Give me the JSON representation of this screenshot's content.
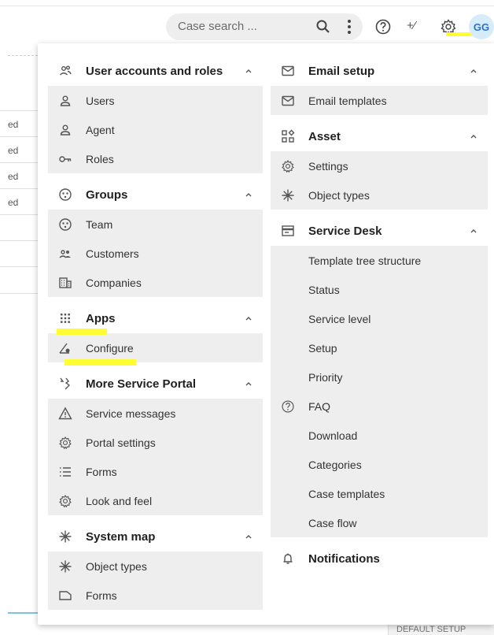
{
  "topbar": {
    "search_placeholder": "Case search ...",
    "avatar_initials": "GG",
    "plus_fx_glyph": "+⁄"
  },
  "background": {
    "rows": [
      "ed",
      "ed",
      "ed",
      "ed"
    ],
    "footer": "DEFAULT SETUP"
  },
  "menu": {
    "left": [
      {
        "title": "User accounts and roles",
        "icon": "users-icon",
        "items": [
          {
            "label": "Users",
            "icon": "person-icon"
          },
          {
            "label": "Agent",
            "icon": "person-icon"
          },
          {
            "label": "Roles",
            "icon": "key-icon"
          }
        ]
      },
      {
        "title": "Groups",
        "icon": "group-icon",
        "items": [
          {
            "label": "Team",
            "icon": "team-icon"
          },
          {
            "label": "Customers",
            "icon": "customers-icon"
          },
          {
            "label": "Companies",
            "icon": "building-icon"
          }
        ]
      },
      {
        "title": "Apps",
        "icon": "apps-grid-icon",
        "items": [
          {
            "label": "Configure",
            "icon": "configure-icon"
          }
        ]
      },
      {
        "title": "More Service Portal",
        "icon": "portal-icon",
        "items": [
          {
            "label": "Service messages",
            "icon": "warning-icon"
          },
          {
            "label": "Portal settings",
            "icon": "gear-icon"
          },
          {
            "label": "Forms",
            "icon": "list-icon"
          },
          {
            "label": "Look and feel",
            "icon": "gear-icon"
          }
        ]
      },
      {
        "title": "System map",
        "icon": "asterisk-icon",
        "items": [
          {
            "label": "Object types",
            "icon": "asterisk-icon"
          },
          {
            "label": "Forms",
            "icon": "form-icon"
          }
        ]
      }
    ],
    "right": [
      {
        "title": "Email setup",
        "icon": "mail-icon",
        "items": [
          {
            "label": "Email templates",
            "icon": "mail-icon"
          }
        ]
      },
      {
        "title": "Asset",
        "icon": "asset-icon",
        "items": [
          {
            "label": "Settings",
            "icon": "gear-icon"
          },
          {
            "label": "Object types",
            "icon": "asterisk-icon"
          }
        ]
      },
      {
        "title": "Service Desk",
        "icon": "desk-icon",
        "items": [
          {
            "label": "Template tree structure",
            "icon": ""
          },
          {
            "label": "Status",
            "icon": ""
          },
          {
            "label": "Service level",
            "icon": ""
          },
          {
            "label": "Setup",
            "icon": ""
          },
          {
            "label": "Priority",
            "icon": ""
          },
          {
            "label": "FAQ",
            "icon": "help-icon"
          },
          {
            "label": "Download",
            "icon": ""
          },
          {
            "label": "Categories",
            "icon": ""
          },
          {
            "label": "Case templates",
            "icon": ""
          },
          {
            "label": "Case flow",
            "icon": ""
          }
        ]
      },
      {
        "title": "Notifications",
        "icon": "bell-icon",
        "items": []
      }
    ]
  },
  "colors": {
    "highlight": "#fffd33",
    "item_bg": "#eeeeee",
    "avatar_bg": "#d7ecfb",
    "avatar_text": "#2b70c9"
  }
}
